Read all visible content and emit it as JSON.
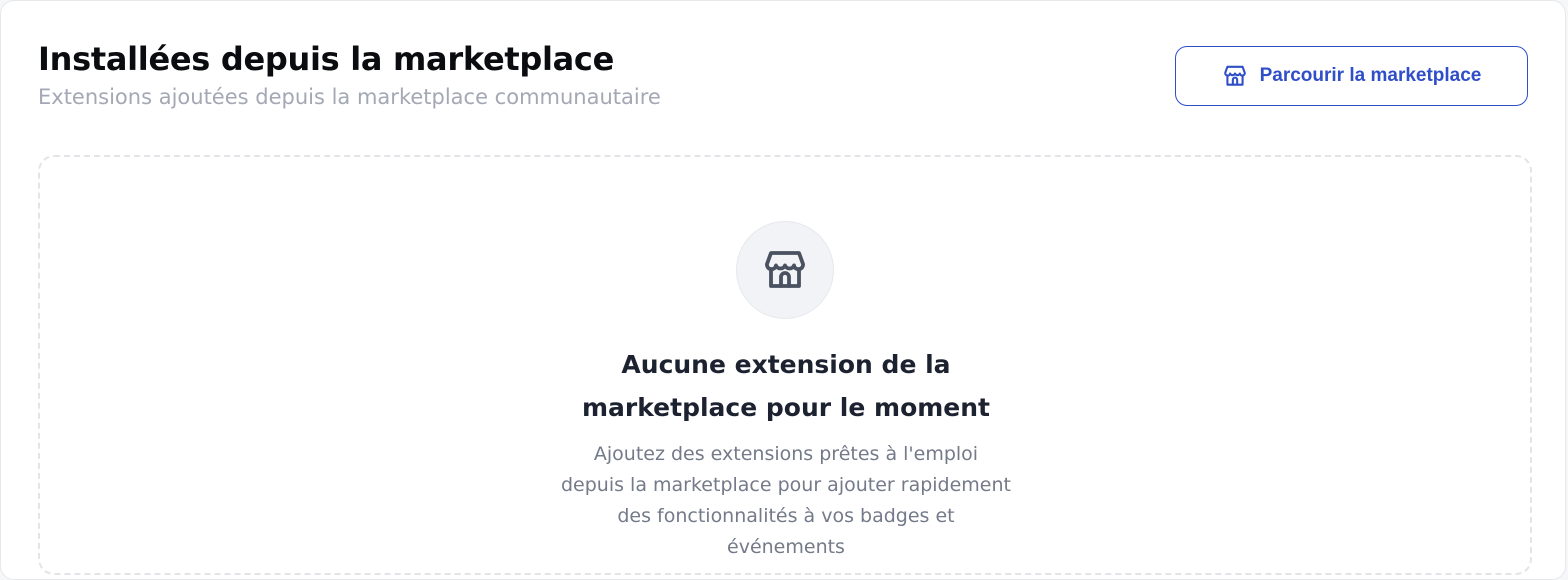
{
  "header": {
    "title": "Installées depuis la marketplace",
    "subtitle": "Extensions ajoutées depuis la marketplace communautaire",
    "browse_button": {
      "label": "Parcourir la marketplace",
      "icon": "store-icon"
    }
  },
  "empty_state": {
    "icon": "store-icon",
    "title": "Aucune extension de la marketplace pour le moment",
    "description": "Ajoutez des extensions prêtes à l'emploi depuis la marketplace pour ajouter rapidement des fonctionnalités à vos badges et événements"
  },
  "colors": {
    "accent": "#2f4ec8",
    "title": "#0b0c10",
    "muted": "#a3a8b4",
    "body_text": "#737a89"
  }
}
